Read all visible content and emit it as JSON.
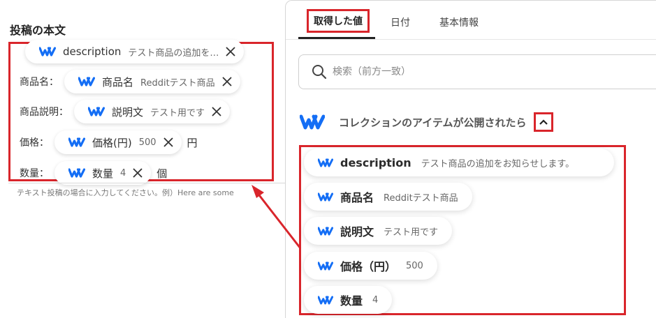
{
  "left": {
    "section_title": "投稿の本文",
    "fields": [
      {
        "label": "",
        "chip_name": "description",
        "chip_value": "テスト商品の追加を…",
        "suffix": ""
      },
      {
        "label": "商品名：",
        "chip_name": "商品名",
        "chip_value": "Redditテスト商品",
        "suffix": ""
      },
      {
        "label": "商品説明：",
        "chip_name": "説明文",
        "chip_value": "テスト用です",
        "suffix": ""
      },
      {
        "label": "価格：",
        "chip_name": "価格(円)",
        "chip_value": "500",
        "suffix": "円"
      },
      {
        "label": "数量：",
        "chip_name": "数量",
        "chip_value": "4",
        "suffix": "個"
      }
    ],
    "hint": "テキスト投稿の場合に入力してください。例）Here are some"
  },
  "right": {
    "tabs": [
      {
        "label": "取得した値",
        "active": true
      },
      {
        "label": "日付",
        "active": false
      },
      {
        "label": "基本情報",
        "active": false
      }
    ],
    "search": {
      "placeholder": "検索（前方一致）"
    },
    "collection_title": "コレクションのアイテムが公開されたら",
    "items": [
      {
        "name": "description",
        "value": "テスト商品の追加をお知らせします。"
      },
      {
        "name": "商品名",
        "value": "Redditテスト商品"
      },
      {
        "name": "説明文",
        "value": "テスト用です"
      },
      {
        "name": "価格（円）",
        "value": "500"
      },
      {
        "name": "数量",
        "value": "4"
      }
    ]
  },
  "icons": {
    "webflow": "webflow-logo-icon",
    "remove": "close-icon",
    "search": "search-icon",
    "collapse": "chevron-up-icon"
  },
  "colors": {
    "highlight_red": "#d9252b",
    "webflow_blue": "#146ef5"
  }
}
